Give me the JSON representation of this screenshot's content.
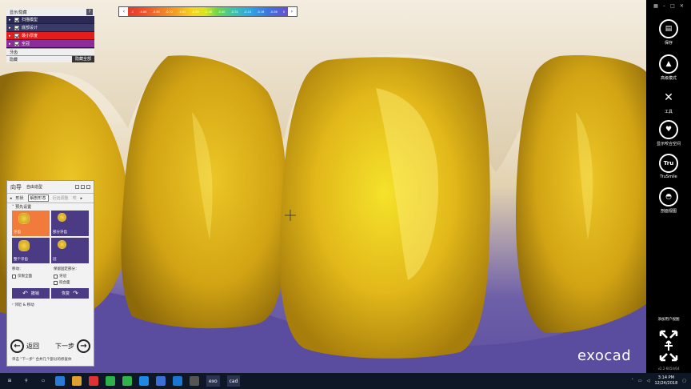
{
  "visibility": {
    "title": "显示/隐藏",
    "help": "?",
    "items": [
      {
        "label": "扫描模型",
        "color": "#2a2a55"
      },
      {
        "label": "底部设计",
        "color": "#3a3a66"
      },
      {
        "label": "最小厚度",
        "color": "#e31c1c"
      },
      {
        "label": "全冠",
        "color": "#8a2d9a"
      }
    ],
    "group1": "牙齿",
    "group2": "隐藏",
    "hide_all": "隐藏全部"
  },
  "scale": {
    "ticks": [
      "-1",
      "-0.88",
      "-0.80",
      "-0.72",
      "-0.64",
      "-0.56",
      "-0.48",
      "-0.40",
      "-0.32",
      "-0.24",
      "-0.16",
      "-0.08",
      "0"
    ]
  },
  "wizard": {
    "title": "向导",
    "subtitle": "自由造型",
    "tabs": [
      "形状",
      "解剖形态",
      "近远调整",
      "咬"
    ],
    "section": "预先设置",
    "cells": [
      "牙齿",
      "部分牙齿",
      "整个牙齿",
      "冠"
    ],
    "move_label": "移动：",
    "keep_label": "保留固定部分：",
    "move_opt": "仅限全面",
    "keep_opts": [
      "牙冠",
      "咬合面"
    ],
    "undo": "撤销",
    "redo": "恢复",
    "fold": "邻近 & 移动",
    "back": "返回",
    "next": "下一步",
    "hint": "单击 \"下一步\" 合并几个部分的修复体"
  },
  "toolbar": {
    "buttons": [
      {
        "label": "保存",
        "icon": "save-icon"
      },
      {
        "label": "高级模式",
        "icon": "graduation-cap-icon"
      },
      {
        "label": "工具",
        "icon": "tools-icon"
      },
      {
        "label": "显示咬合空间",
        "icon": "tooth-icon"
      },
      {
        "label": "TruSmile",
        "icon": "trusmile-icon"
      },
      {
        "label": "剖面视图",
        "icon": "cross-section-icon"
      }
    ],
    "add_view": "添加用户视图",
    "version": "v2.2-6654/64"
  },
  "logo": "exocad",
  "taskbar": {
    "apps": [
      "exo",
      "cad"
    ],
    "time": "3:14 PM",
    "date": "12/24/2018"
  },
  "colors": {
    "crown_yellow": "#e6b81c",
    "base_purple": "#5a4c9e",
    "gum_beige": "#eee4d0",
    "accent_orange": "#f07b3a",
    "panel_purple": "#4b3a84"
  }
}
